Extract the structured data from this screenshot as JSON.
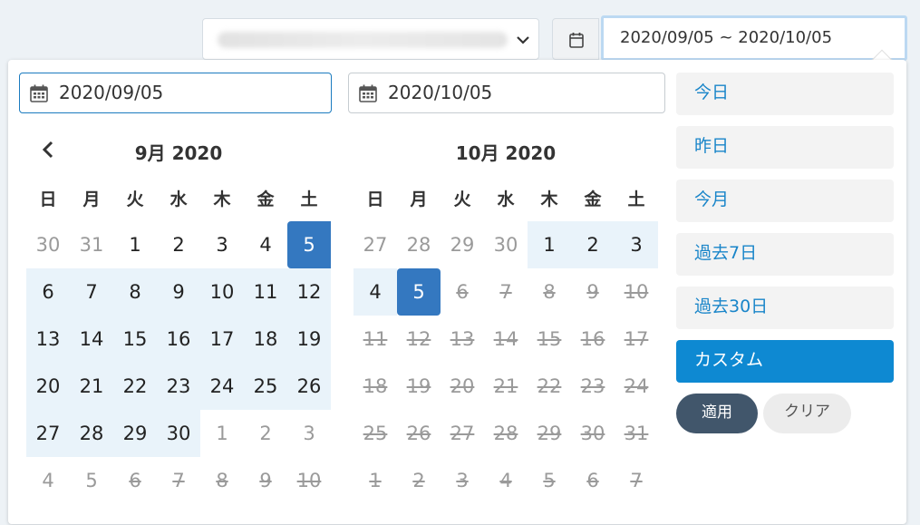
{
  "topbar": {
    "range_value": "2020/09/05 ~ 2020/10/05"
  },
  "left": {
    "start_date": "2020/09/05",
    "title": "9月 2020",
    "days": [
      {
        "n": "30",
        "s": "off"
      },
      {
        "n": "31",
        "s": "off"
      },
      {
        "n": "1",
        "s": ""
      },
      {
        "n": "2",
        "s": ""
      },
      {
        "n": "3",
        "s": ""
      },
      {
        "n": "4",
        "s": ""
      },
      {
        "n": "5",
        "s": "sel-start"
      },
      {
        "n": "6",
        "s": "in"
      },
      {
        "n": "7",
        "s": "in"
      },
      {
        "n": "8",
        "s": "in"
      },
      {
        "n": "9",
        "s": "in"
      },
      {
        "n": "10",
        "s": "in"
      },
      {
        "n": "11",
        "s": "in"
      },
      {
        "n": "12",
        "s": "in"
      },
      {
        "n": "13",
        "s": "in"
      },
      {
        "n": "14",
        "s": "in"
      },
      {
        "n": "15",
        "s": "in"
      },
      {
        "n": "16",
        "s": "in"
      },
      {
        "n": "17",
        "s": "in"
      },
      {
        "n": "18",
        "s": "in"
      },
      {
        "n": "19",
        "s": "in"
      },
      {
        "n": "20",
        "s": "in"
      },
      {
        "n": "21",
        "s": "in"
      },
      {
        "n": "22",
        "s": "in"
      },
      {
        "n": "23",
        "s": "in"
      },
      {
        "n": "24",
        "s": "in"
      },
      {
        "n": "25",
        "s": "in"
      },
      {
        "n": "26",
        "s": "in"
      },
      {
        "n": "27",
        "s": "in"
      },
      {
        "n": "28",
        "s": "in"
      },
      {
        "n": "29",
        "s": "in"
      },
      {
        "n": "30",
        "s": "in"
      },
      {
        "n": "1",
        "s": "off"
      },
      {
        "n": "2",
        "s": "off"
      },
      {
        "n": "3",
        "s": "off"
      },
      {
        "n": "4",
        "s": "off"
      },
      {
        "n": "5",
        "s": "off"
      },
      {
        "n": "6",
        "s": "dis"
      },
      {
        "n": "7",
        "s": "dis"
      },
      {
        "n": "8",
        "s": "dis"
      },
      {
        "n": "9",
        "s": "dis"
      },
      {
        "n": "10",
        "s": "dis"
      }
    ]
  },
  "right": {
    "end_date": "2020/10/05",
    "title": "10月 2020",
    "days": [
      {
        "n": "27",
        "s": "off"
      },
      {
        "n": "28",
        "s": "off"
      },
      {
        "n": "29",
        "s": "off"
      },
      {
        "n": "30",
        "s": "off"
      },
      {
        "n": "1",
        "s": "in"
      },
      {
        "n": "2",
        "s": "in"
      },
      {
        "n": "3",
        "s": "in"
      },
      {
        "n": "4",
        "s": "in"
      },
      {
        "n": "5",
        "s": "sel"
      },
      {
        "n": "6",
        "s": "dis"
      },
      {
        "n": "7",
        "s": "dis"
      },
      {
        "n": "8",
        "s": "dis"
      },
      {
        "n": "9",
        "s": "dis"
      },
      {
        "n": "10",
        "s": "dis"
      },
      {
        "n": "11",
        "s": "dis"
      },
      {
        "n": "12",
        "s": "dis"
      },
      {
        "n": "13",
        "s": "dis"
      },
      {
        "n": "14",
        "s": "dis"
      },
      {
        "n": "15",
        "s": "dis"
      },
      {
        "n": "16",
        "s": "dis"
      },
      {
        "n": "17",
        "s": "dis"
      },
      {
        "n": "18",
        "s": "dis"
      },
      {
        "n": "19",
        "s": "dis"
      },
      {
        "n": "20",
        "s": "dis"
      },
      {
        "n": "21",
        "s": "dis"
      },
      {
        "n": "22",
        "s": "dis"
      },
      {
        "n": "23",
        "s": "dis"
      },
      {
        "n": "24",
        "s": "dis"
      },
      {
        "n": "25",
        "s": "dis"
      },
      {
        "n": "26",
        "s": "dis"
      },
      {
        "n": "27",
        "s": "dis"
      },
      {
        "n": "28",
        "s": "dis"
      },
      {
        "n": "29",
        "s": "dis"
      },
      {
        "n": "30",
        "s": "dis"
      },
      {
        "n": "31",
        "s": "dis"
      },
      {
        "n": "1",
        "s": "dis"
      },
      {
        "n": "2",
        "s": "dis"
      },
      {
        "n": "3",
        "s": "dis"
      },
      {
        "n": "4",
        "s": "dis"
      },
      {
        "n": "5",
        "s": "dis"
      },
      {
        "n": "6",
        "s": "dis"
      },
      {
        "n": "7",
        "s": "dis"
      }
    ]
  },
  "weekdays": [
    "日",
    "月",
    "火",
    "水",
    "木",
    "金",
    "土"
  ],
  "ranges": {
    "items": [
      {
        "label": "今日"
      },
      {
        "label": "昨日"
      },
      {
        "label": "今月"
      },
      {
        "label": "過去7日"
      },
      {
        "label": "過去30日"
      },
      {
        "label": "カスタム",
        "active": true
      }
    ],
    "apply_label": "適用",
    "clear_label": "クリア"
  },
  "colors": {
    "accent": "#0e89d2",
    "selected": "#3478c0",
    "in_range": "#e9f3fa",
    "apply_bg": "#41566b"
  }
}
